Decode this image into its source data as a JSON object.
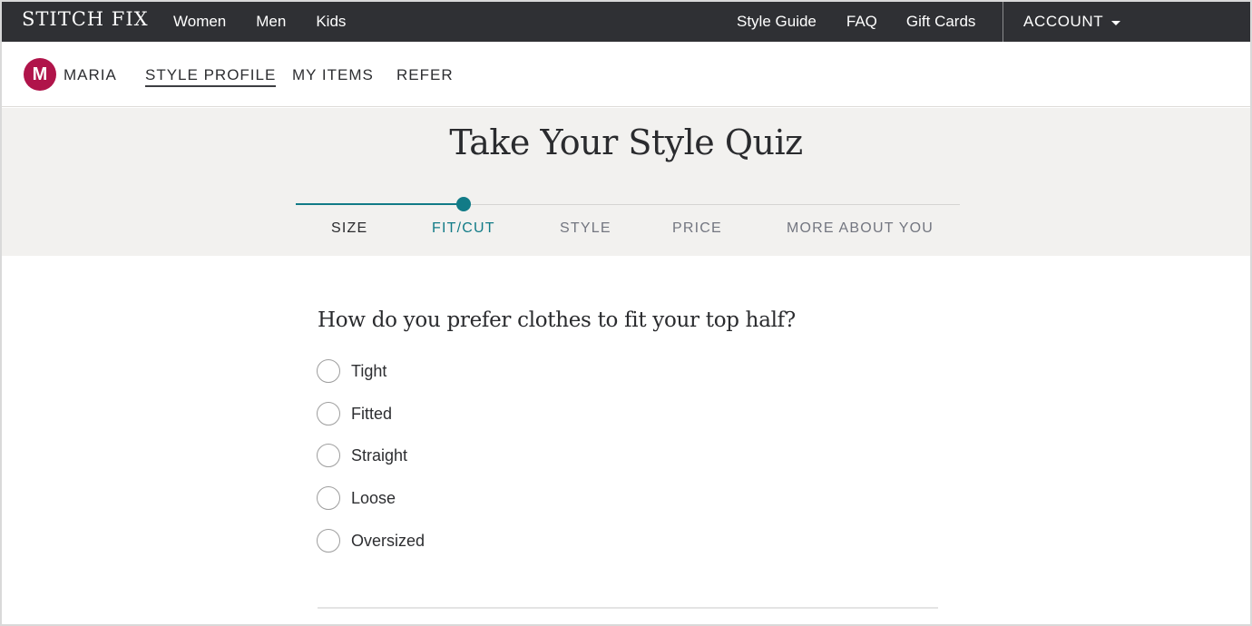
{
  "topbar": {
    "logo": "STITCH FIX",
    "left_nav": [
      "Women",
      "Men",
      "Kids"
    ],
    "right_nav": [
      "Style Guide",
      "FAQ",
      "Gift Cards"
    ],
    "account_label": "ACCOUNT",
    "account_icon": "caret-down-icon"
  },
  "subnav": {
    "avatar_initial": "M",
    "avatar_color": "#b0144a",
    "user_name": "MARIA",
    "items": [
      "STYLE PROFILE",
      "MY ITEMS",
      "REFER"
    ],
    "active_item": "STYLE PROFILE"
  },
  "quiz": {
    "title": "Take Your Style Quiz",
    "steps": [
      "SIZE",
      "FIT/CUT",
      "STYLE",
      "PRICE",
      "MORE ABOUT YOU"
    ],
    "current_step": "FIT/CUT",
    "current_step_index": 1,
    "accent_color": "#127b87",
    "question": "How do you prefer clothes to fit your top half?",
    "options": [
      "Tight",
      "Fitted",
      "Straight",
      "Loose",
      "Oversized"
    ],
    "selected_option": null
  }
}
